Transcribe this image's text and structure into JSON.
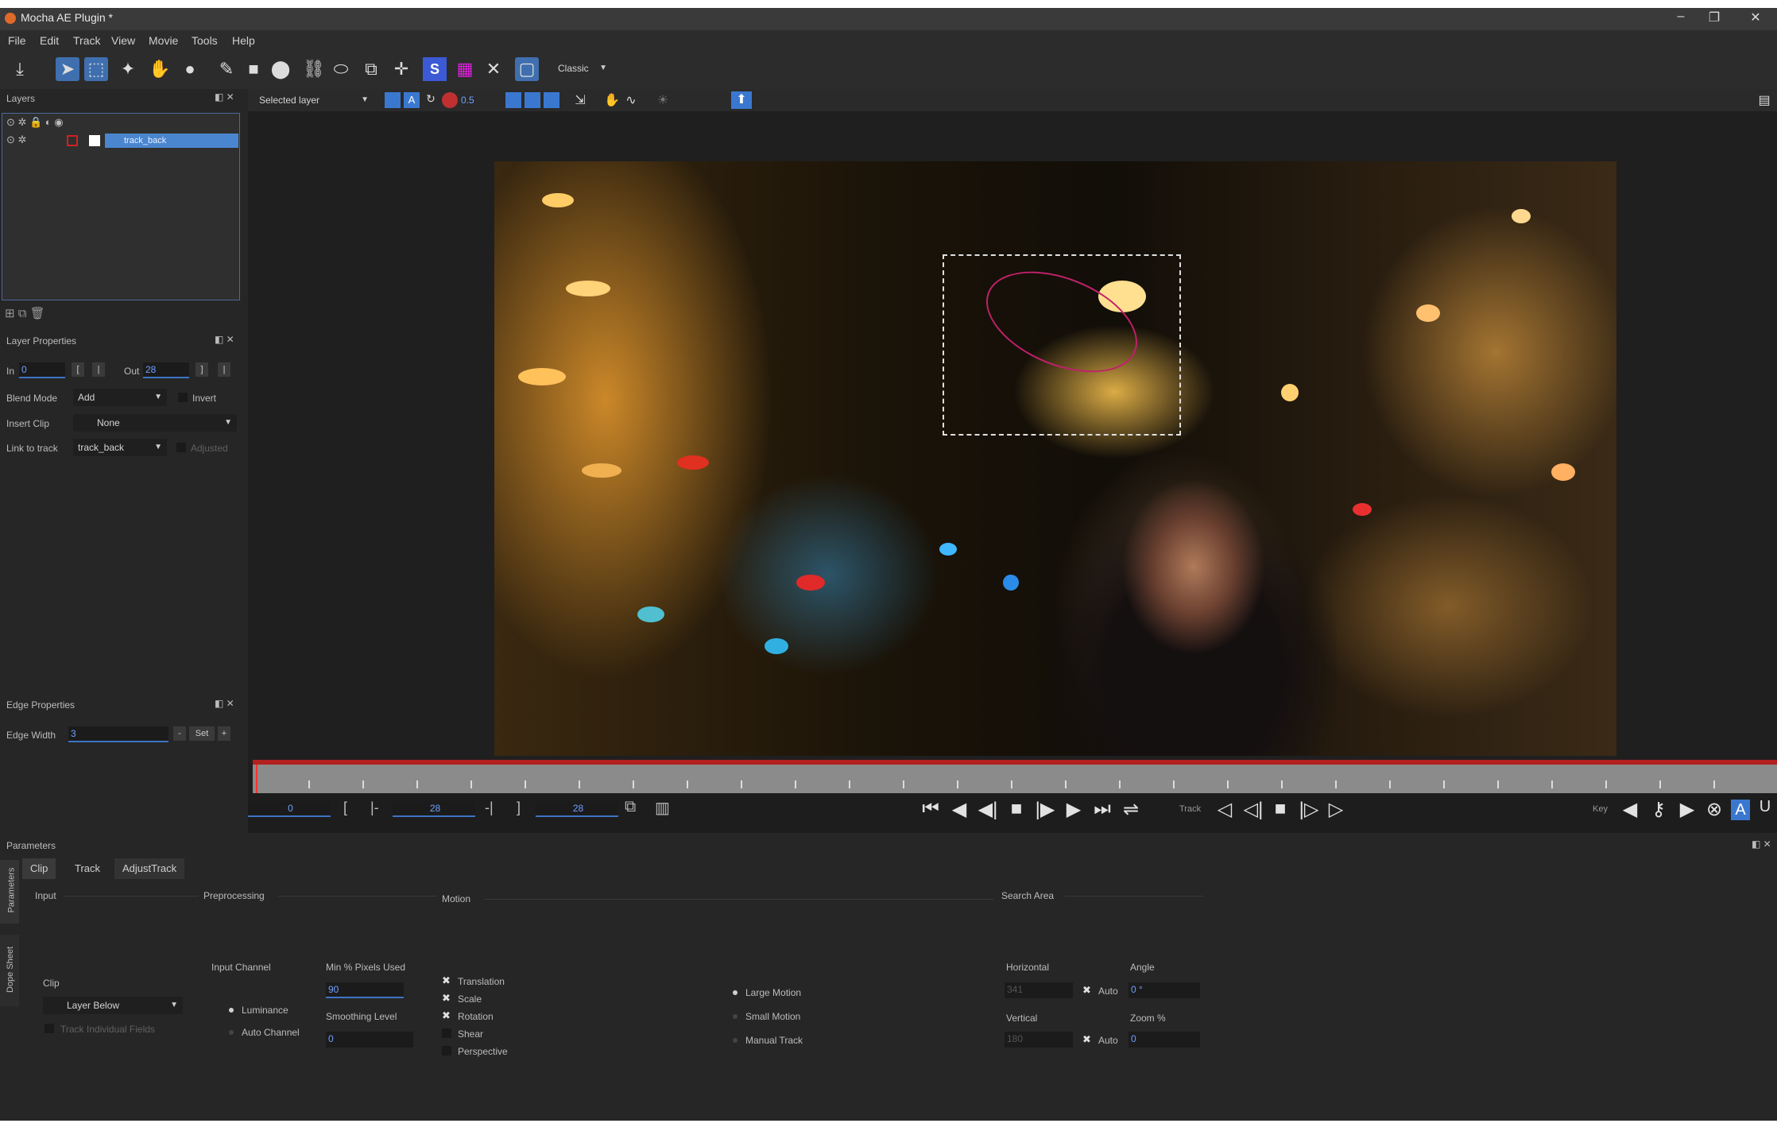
{
  "window": {
    "title": "Mocha AE Plugin *",
    "restore_glyph": "❐",
    "close_glyph": "✕"
  },
  "menu": [
    "File",
    "Edit",
    "Track",
    "View",
    "Movie",
    "Tools",
    "Help"
  ],
  "toolbar": {
    "workspace": "Classic"
  },
  "subtoolbar": {
    "layer_select": "Selected layer",
    "opacity": "0.5"
  },
  "layers_panel": {
    "title": "Layers",
    "layer_name": "track_back"
  },
  "layer_properties": {
    "title": "Layer Properties",
    "in_label": "In",
    "in_value": "0",
    "out_label": "Out",
    "out_value": "28",
    "blend_mode_label": "Blend Mode",
    "blend_mode_value": "Add",
    "invert_label": "Invert",
    "insert_clip_label": "Insert Clip",
    "insert_clip_value": "None",
    "link_label": "Link to track",
    "link_value": "track_back",
    "adjusted_label": "Adjusted"
  },
  "edge_properties": {
    "title": "Edge Properties",
    "edge_width_label": "Edge Width",
    "edge_width_value": "3",
    "minus": "-",
    "set_label": "Set",
    "plus": "+"
  },
  "transport": {
    "current_frame": "0",
    "in_frame": "28",
    "out_frame": "28",
    "track_label": "Track",
    "key_label": "Key"
  },
  "parameters": {
    "title": "Parameters",
    "side_tabs": [
      "Parameters",
      "Dope Sheet"
    ],
    "tabs": [
      "Clip",
      "Track",
      "AdjustTrack"
    ],
    "input": {
      "title": "Input",
      "clip_label": "Clip",
      "clip_value": "Layer Below",
      "track_fields": "Track Individual Fields"
    },
    "preprocessing": {
      "title": "Preprocessing",
      "input_channel_label": "Input Channel",
      "luminance": "Luminance",
      "auto_channel": "Auto Channel",
      "min_pixels_label": "Min % Pixels Used",
      "min_pixels_value": "90",
      "smoothing_label": "Smoothing Level",
      "smoothing_value": "0"
    },
    "motion": {
      "title": "Motion",
      "options": [
        {
          "label": "Translation",
          "checked": true
        },
        {
          "label": "Scale",
          "checked": true
        },
        {
          "label": "Rotation",
          "checked": true
        },
        {
          "label": "Shear",
          "checked": false
        },
        {
          "label": "Perspective",
          "checked": false
        }
      ],
      "modes": [
        "Large Motion",
        "Small Motion",
        "Manual Track"
      ]
    },
    "search_area": {
      "title": "Search Area",
      "horizontal_label": "Horizontal",
      "horizontal_value": "341",
      "auto1": "Auto",
      "vertical_label": "Vertical",
      "vertical_value": "180",
      "auto2": "Auto",
      "angle_label": "Angle",
      "angle_value": "0 °",
      "zoom_label": "Zoom %",
      "zoom_value": "0"
    }
  }
}
